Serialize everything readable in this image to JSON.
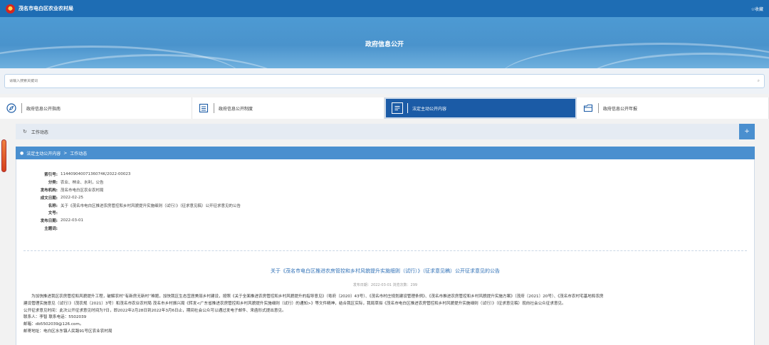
{
  "site": {
    "title": "茂名市电白区农业农村局",
    "favorite": "☆收藏"
  },
  "banner": {
    "title": "政府信息公开"
  },
  "search": {
    "placeholder": "请输入搜索关键词"
  },
  "tabs": [
    {
      "label": "政府信息公开指南",
      "icon": "compass-icon"
    },
    {
      "label": "政府信息公开制度",
      "icon": "document-list-icon"
    },
    {
      "label": "法定主动公开内容",
      "icon": "document-icon"
    },
    {
      "label": "政府信息公开年报",
      "icon": "folder-icon"
    }
  ],
  "section": {
    "title": "工作动态"
  },
  "breadcrumb": {
    "home": "法定主动公开内容",
    "sep": ">",
    "current": "工作动态"
  },
  "info": [
    {
      "label": "索引号:",
      "value": "11440904007136074K/2022-00023"
    },
    {
      "label": "分类:",
      "value": "农业、林业、水利，公告"
    },
    {
      "label": "发布机构:",
      "value": "茂名市电白区农业农村局"
    },
    {
      "label": "成文日期:",
      "value": "2022-02-25"
    },
    {
      "label": "名称:",
      "value": "关于《茂名市电白区推进农房管控和乡村风貌提升实施细则（试行）》（征求意见稿）公开征求意见的公告"
    },
    {
      "label": "文号:",
      "value": ""
    },
    {
      "label": "发布日期:",
      "value": "2022-03-01"
    },
    {
      "label": "主题词:",
      "value": ""
    }
  ],
  "article": {
    "title": "关于《茂名市电白区推进农房管控和乡村风貌提升实施细则（试行）》（征求意见稿）公开征求意见的公告",
    "meta": "发布日期：2022-03-01  浏览次数：299",
    "paragraphs": [
      "为加快推进我区农房管控和风貌提升工程，破解农村“有新房无新村”难题，加快我区生态宜居美丽乡村建设，按照《关于全面推进农房管控和乡村风貌提升的指导意见》（粤府〔2020〕43号）、《茂名市村庄规划建设管理条例》、《茂名市推进农房管控和乡村风貌提升实施方案》（茂府〔2021〕20号）、《茂名市农村宅基地和农房",
      "建设管理实施意见（试行）》（茂农规〔2021〕3号）和茂名市农业农村局 茂名市乡村振兴局《转发<广东省推进农房管控和乡村风貌提升实施细则（试行）的通知>》等文件精神，结合我区实际，我局草拟《茂名市电白区推进农房管控和乡村风貌提升实施细则（试行）》（征求意见稿）现向社会公众征求意见。",
      "公开征求意见时间：此次公开征求意见时间为7日，即2022年2月28日到2022年3月6日止，期间社会公众可以通过发电子邮件、来函形式提出意见。",
      "联系人：李智  联系电话：5502039",
      "邮箱：db5502039@126.com。",
      "邮寄地址：电白区水东镇人民路91号区农业农村局"
    ]
  },
  "colors": {
    "topbar": "#1e6db4",
    "accent": "#4a8fcf",
    "active_tab": "#1b5ba6",
    "title_link": "#2d6fb6"
  }
}
